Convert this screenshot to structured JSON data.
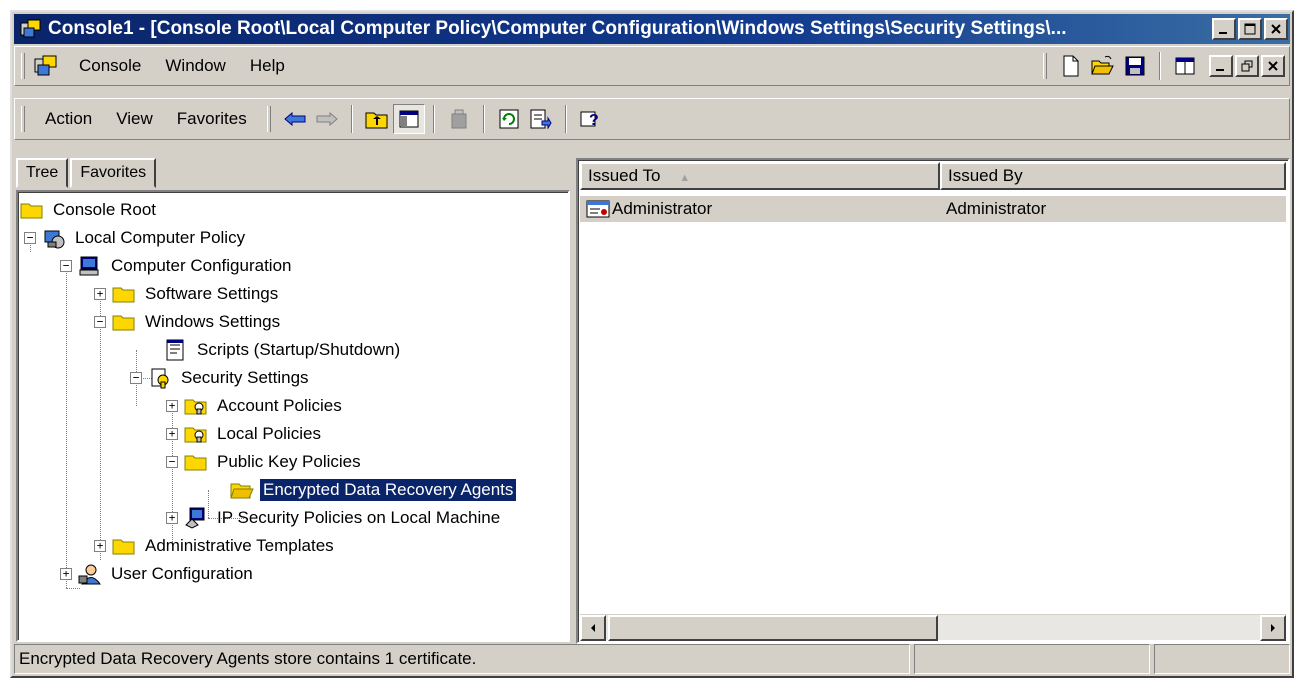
{
  "window": {
    "title": "Console1 - [Console Root\\Local Computer Policy\\Computer Configuration\\Windows Settings\\Security Settings\\...",
    "title_color": "#0a246a"
  },
  "menu": {
    "items": [
      {
        "label": "Console"
      },
      {
        "label": "Window"
      },
      {
        "label": "Help"
      }
    ]
  },
  "toolbar": {
    "items": [
      {
        "label": "Action"
      },
      {
        "label": "View"
      },
      {
        "label": "Favorites"
      }
    ]
  },
  "tabs": [
    {
      "label": "Tree",
      "active": true
    },
    {
      "label": "Favorites",
      "active": false
    }
  ],
  "tree": {
    "nodes": [
      {
        "label": "Console Root",
        "icon": "folder-icon"
      },
      {
        "label": "Local Computer Policy",
        "icon": "policy-icon",
        "expander": "−"
      },
      {
        "label": "Computer Configuration",
        "icon": "computer-icon",
        "expander": "−"
      },
      {
        "label": "Software Settings",
        "icon": "folder-icon",
        "expander": "+"
      },
      {
        "label": "Windows Settings",
        "icon": "folder-icon",
        "expander": "−"
      },
      {
        "label": "Scripts (Startup/Shutdown)",
        "icon": "script-icon"
      },
      {
        "label": "Security Settings",
        "icon": "security-icon",
        "expander": "−"
      },
      {
        "label": "Account Policies",
        "icon": "policy-folder-icon",
        "expander": "+"
      },
      {
        "label": "Local Policies",
        "icon": "policy-folder-icon",
        "expander": "+"
      },
      {
        "label": "Public Key Policies",
        "icon": "folder-icon",
        "expander": "−"
      },
      {
        "label": "Encrypted Data Recovery Agents",
        "icon": "open-folder-icon",
        "selected": true
      },
      {
        "label": "IP Security Policies on Local Machine",
        "icon": "ip-security-icon",
        "expander": "+"
      },
      {
        "label": "Administrative Templates",
        "icon": "folder-icon",
        "expander": "+"
      },
      {
        "label": "User Configuration",
        "icon": "user-config-icon",
        "expander": "+"
      }
    ]
  },
  "list": {
    "columns": [
      {
        "label": "Issued To",
        "sort": "▲"
      },
      {
        "label": "Issued By"
      }
    ],
    "rows": [
      {
        "issued_to": "Administrator",
        "issued_by": "Administrator",
        "icon": "certificate-icon"
      }
    ]
  },
  "status": {
    "text": "Encrypted Data Recovery Agents store contains 1 certificate."
  }
}
